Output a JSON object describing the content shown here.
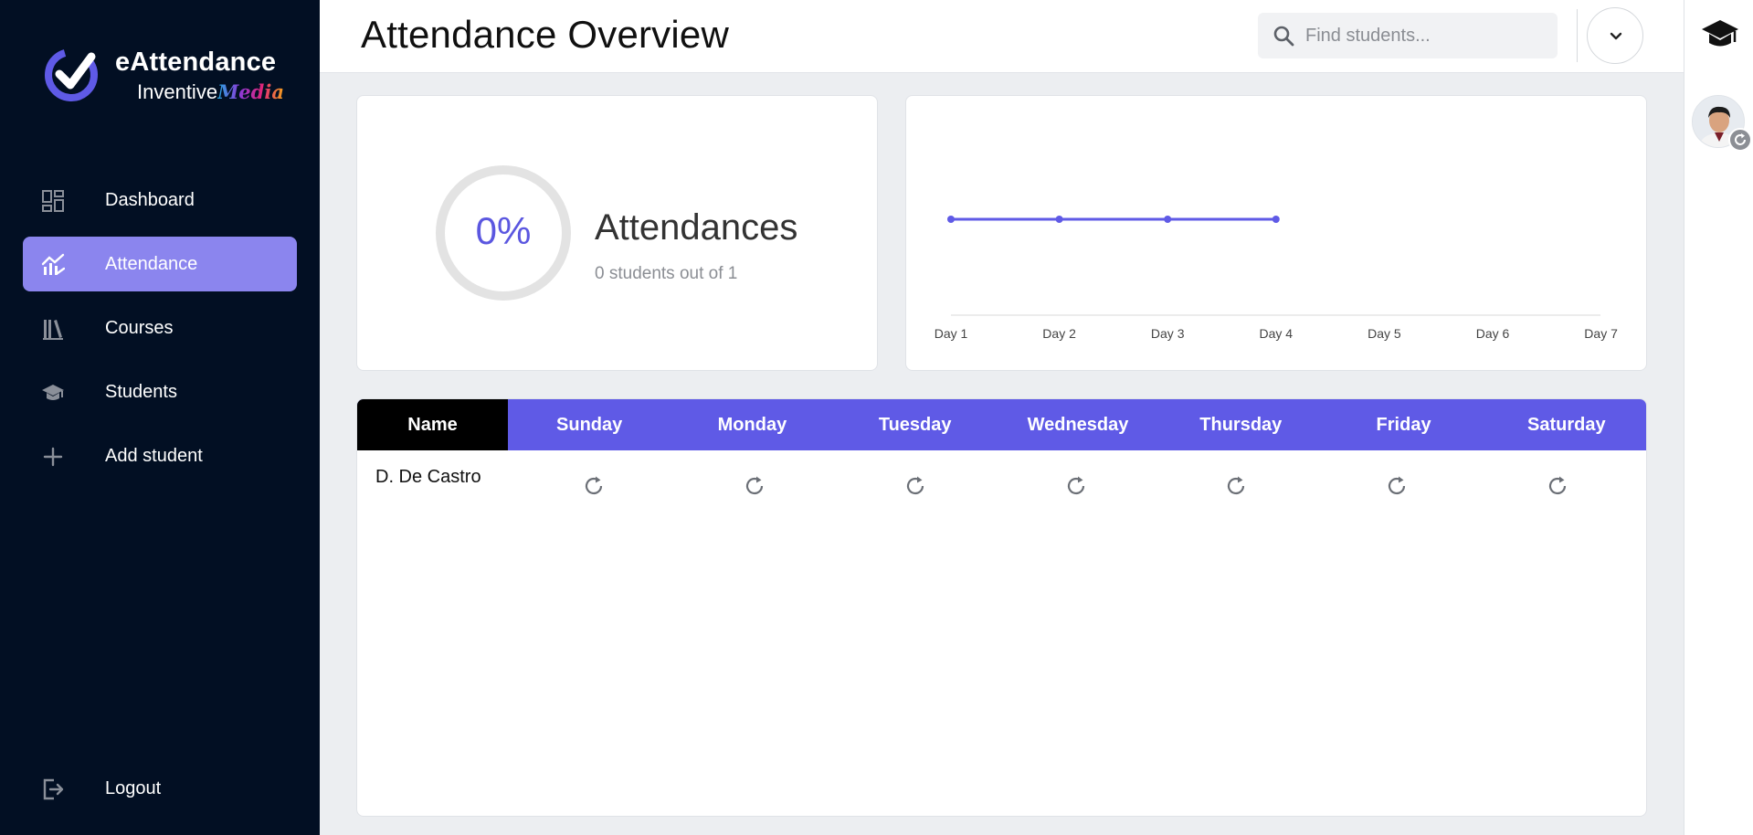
{
  "brand": {
    "title": "eAttendance",
    "subtitle": "Inventive",
    "subtitle_accent": "Media",
    "accent_color": "#5b57e0",
    "active_nav_color": "#8b85ee",
    "sidebar_color": "#020f23"
  },
  "sidebar": {
    "items": [
      {
        "label": "Dashboard",
        "icon": "dashboard-icon"
      },
      {
        "label": "Attendance",
        "icon": "chart-trend-icon",
        "active": true
      },
      {
        "label": "Courses",
        "icon": "books-icon"
      },
      {
        "label": "Students",
        "icon": "graduation-cap-icon"
      },
      {
        "label": "Add student",
        "icon": "plus-icon"
      }
    ],
    "logout_label": "Logout"
  },
  "header": {
    "title": "Attendance Overview",
    "search_placeholder": "Find students...",
    "search_value": ""
  },
  "stats": {
    "percent_label": "0%",
    "percent_value": 0,
    "title": "Attendances",
    "subtitle": "0 students out of 1"
  },
  "chart_data": {
    "type": "line",
    "categories": [
      "Day 1",
      "Day 2",
      "Day 3",
      "Day 4",
      "Day 5",
      "Day 6",
      "Day 7"
    ],
    "series": [
      {
        "values": [
          0,
          0,
          0,
          0,
          null,
          null,
          null
        ],
        "color": "#5f5ae6"
      }
    ],
    "grid": false,
    "legend": "none"
  },
  "table": {
    "columns": [
      "Name",
      "Sunday",
      "Monday",
      "Tuesday",
      "Wednesday",
      "Thursday",
      "Friday",
      "Saturday"
    ],
    "rows": [
      {
        "name": "D. De Castro",
        "status": [
          "refresh-icon",
          "refresh-icon",
          "refresh-icon",
          "refresh-icon",
          "refresh-icon",
          "refresh-icon",
          "refresh-icon"
        ]
      }
    ]
  }
}
